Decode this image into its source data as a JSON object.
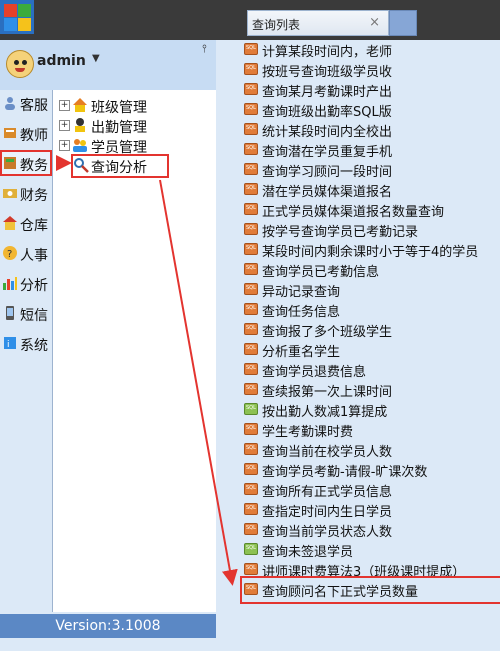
{
  "header": {
    "tab_title": "查询列表",
    "tab_close": "×"
  },
  "user": {
    "name": "admin",
    "caret": "▼",
    "pin": "📌"
  },
  "nav": [
    {
      "label": "客服",
      "icon": "person-icon"
    },
    {
      "label": "教师",
      "icon": "teacher-icon"
    },
    {
      "label": "教务",
      "icon": "academic-icon",
      "active": true
    },
    {
      "label": "财务",
      "icon": "finance-icon"
    },
    {
      "label": "仓库",
      "icon": "warehouse-icon"
    },
    {
      "label": "人事",
      "icon": "hr-icon"
    },
    {
      "label": "分析",
      "icon": "chart-icon"
    },
    {
      "label": "短信",
      "icon": "phone-icon"
    },
    {
      "label": "系统",
      "icon": "system-icon"
    }
  ],
  "tree": [
    {
      "label": "班级管理",
      "expand": "+",
      "icon": "house-icon"
    },
    {
      "label": "出勤管理",
      "expand": "+",
      "icon": "attendance-icon"
    },
    {
      "label": "学员管理",
      "expand": "+",
      "icon": "students-icon"
    },
    {
      "label": "查询分析",
      "expand": "",
      "icon": "search-icon"
    }
  ],
  "version": "Version:3.1008",
  "queries": [
    "计算某段时间内，老师",
    "按班号查询班级学员收",
    "查询某月考勤课时产出",
    "查询班级出勤率SQL版",
    "统计某段时间内全校出",
    "查询潜在学员重复手机",
    "查询学习顾问一段时间",
    "潜在学员媒体渠道报名",
    "正式学员媒体渠道报名数量查询",
    "按学号查询学员已考勤记录",
    "某段时间内剩余课时小于等于4的学员",
    "查询学员已考勤信息",
    "异动记录查询",
    "查询任务信息",
    "查询报了多个班级学生",
    "分析重名学生",
    "查询学员退费信息",
    "查续报第一次上课时间",
    "按出勤人数减1算提成",
    "学生考勤课时费",
    "查询当前在校学员人数",
    "查询学员考勤-请假-旷课次数",
    "查询所有正式学员信息",
    "查指定时间内生日学员",
    "查询当前学员状态人数",
    "查询未签退学员",
    "讲师课时费算法3（班级课时提成）",
    "查询顾问名下正式学员数量"
  ]
}
